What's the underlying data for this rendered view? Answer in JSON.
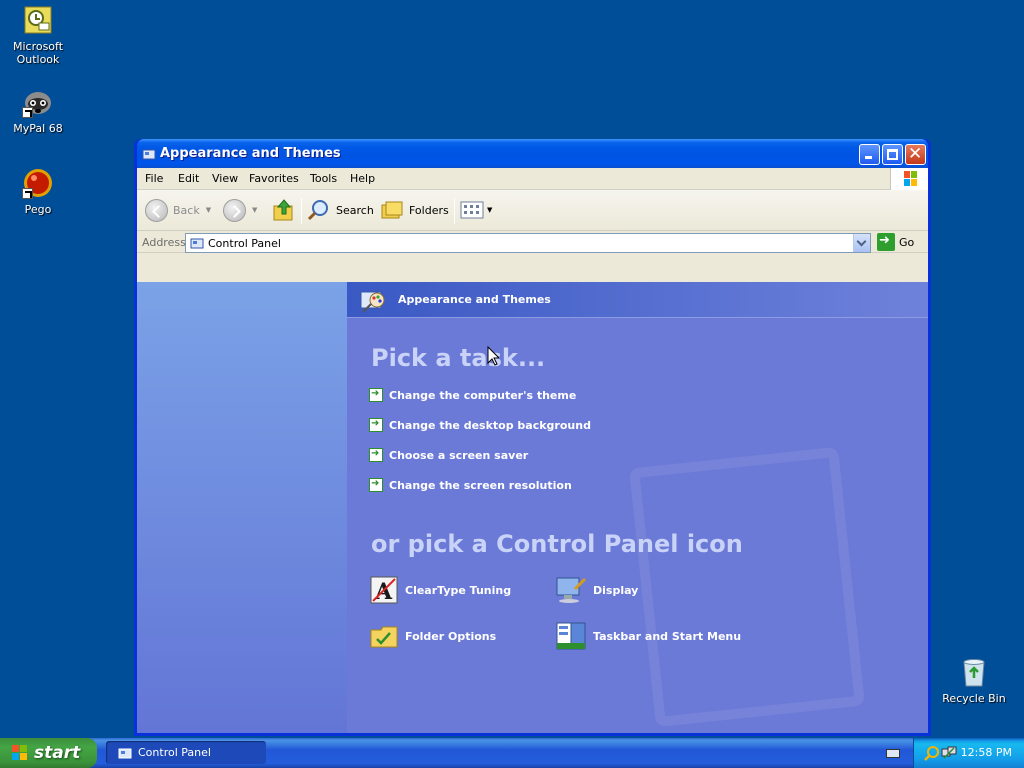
{
  "desktop": {
    "icons": [
      {
        "label": "Microsoft Outlook"
      },
      {
        "label": "MyPal 68"
      },
      {
        "label": "Pego"
      },
      {
        "label": "Recycle Bin"
      }
    ]
  },
  "window": {
    "title": "Appearance and Themes",
    "menu": [
      "File",
      "Edit",
      "View",
      "Favorites",
      "Tools",
      "Help"
    ],
    "toolbar": {
      "back": "Back",
      "search": "Search",
      "folders": "Folders"
    },
    "address": {
      "label": "Address",
      "value": "Control Panel",
      "go": "Go"
    },
    "panel": {
      "header": "Appearance and Themes",
      "pick_task": "Pick a task...",
      "tasks": [
        "Change the computer's theme",
        "Change the desktop background",
        "Choose a screen saver",
        "Change the screen resolution"
      ],
      "or_pick": "or pick a Control Panel icon",
      "icons": [
        {
          "label": "ClearType Tuning",
          "icon": "cleartype-icon"
        },
        {
          "label": "Display",
          "icon": "display-icon"
        },
        {
          "label": "Folder Options",
          "icon": "folder-options-icon"
        },
        {
          "label": "Taskbar and Start Menu",
          "icon": "taskbar-icon"
        }
      ]
    }
  },
  "taskbar": {
    "start": "start",
    "task_item": "Control Panel",
    "clock": "12:58 PM"
  },
  "colors": {
    "desktop": "#004e98",
    "title_blue": "#0054e3",
    "panel_blue": "#6c7ad7",
    "start_green": "#3a933a"
  }
}
